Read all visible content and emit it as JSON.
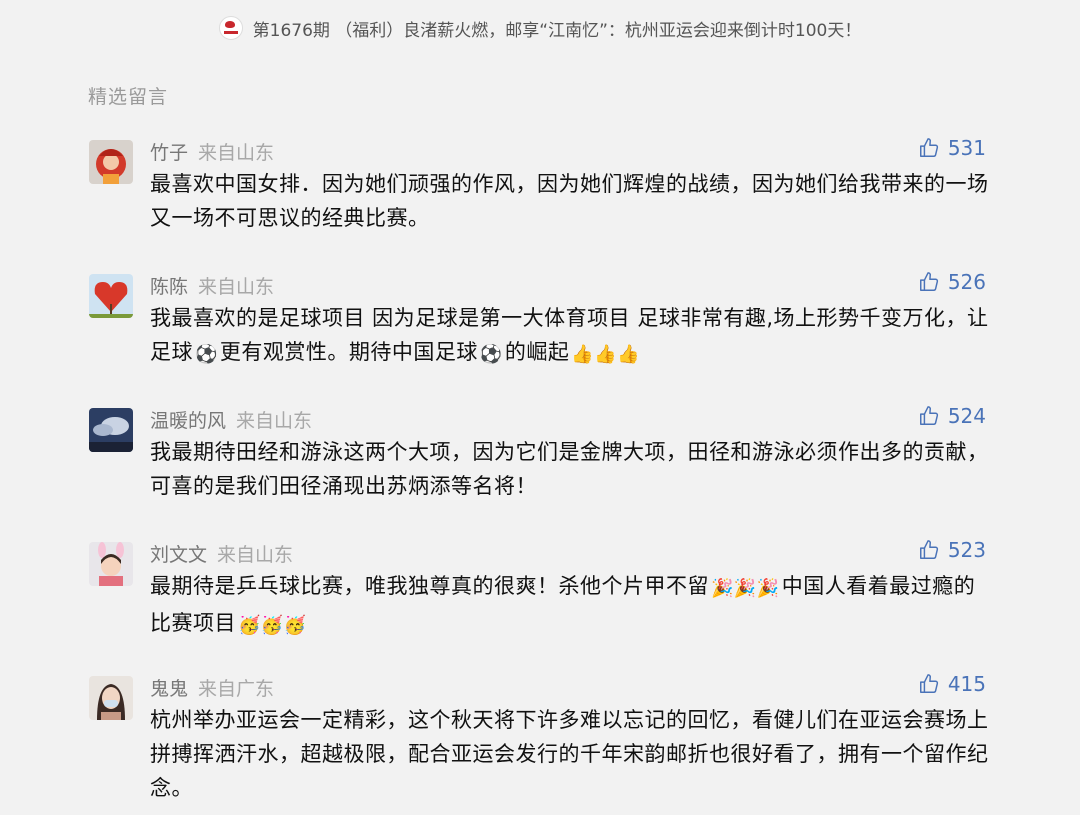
{
  "header": {
    "article_title": "第1676期 （福利）良渚薪火燃，邮享“江南忆”：杭州亚运会迎来倒计时100天！"
  },
  "section": {
    "title": "精选留言"
  },
  "comments": [
    {
      "name": "竹子",
      "location": "来自山东",
      "likes": "531",
      "text": "最喜欢中国女排．因为她们顽强的作风，因为她们辉煌的战绩，因为她们给我带来的一场又一场不可思议的经典比赛。"
    },
    {
      "name": "陈陈",
      "location": "来自山东",
      "likes": "526",
      "text1": "我最喜欢的是足球项目 因为足球是第一大体育项目 足球非常有趣,场上形势千变万化，让足球",
      "text2": "更有观赏性。期待中国足球",
      "text3": "的崛起",
      "emoji_ball": "⚽",
      "emoji_thumbs": "👍👍👍"
    },
    {
      "name": "温暖的风",
      "location": "来自山东",
      "likes": "524",
      "text": "我最期待田经和游泳这两个大项，因为它们是金牌大项，田径和游泳必须作出多的贡献，可喜的是我们田径涌现出苏炳添等名将！"
    },
    {
      "name": "刘文文",
      "location": "来自山东",
      "likes": "523",
      "text1": "最期待是乒乓球比赛，唯我独尊真的很爽！杀他个片甲不留",
      "emoji_party": "🎉🎉🎉",
      "text2": "中国人看着最过瘾的比赛项目",
      "emoji_666": "🥳🥳🥳"
    },
    {
      "name": "鬼鬼",
      "location": "来自广东",
      "likes": "415",
      "text": "杭州举办亚运会一定精彩，这个秋天将下许多难以忘记的回忆，看健儿们在亚运会赛场上拼搏挥洒汗水，超越极限，配合亚运会发行的千年宋韵邮折也很好看了，拥有一个留作纪念。"
    }
  ],
  "icons": {
    "like": "thumbs-up-outline-icon"
  },
  "colors": {
    "background": "#f2f2f2",
    "like_blue": "#4a73b8",
    "name_gray": "#777777",
    "location_gray": "#a8a8a8"
  }
}
